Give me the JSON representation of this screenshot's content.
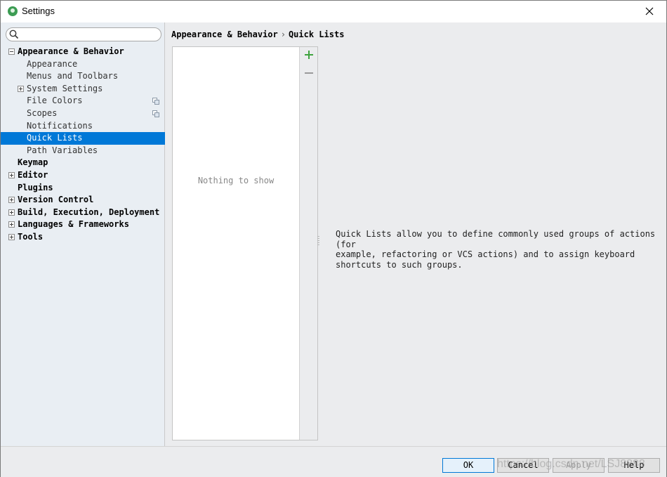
{
  "window": {
    "title": "Settings"
  },
  "search": {
    "placeholder": "",
    "value": ""
  },
  "tree": [
    {
      "label": "Appearance & Behavior",
      "level": 0,
      "expander": "minus",
      "selected": false,
      "icon": null
    },
    {
      "label": "Appearance",
      "level": 1,
      "expander": null,
      "selected": false,
      "icon": null
    },
    {
      "label": "Menus and Toolbars",
      "level": 1,
      "expander": null,
      "selected": false,
      "icon": null
    },
    {
      "label": "System Settings",
      "level": 1,
      "expander": "plus",
      "selected": false,
      "icon": null
    },
    {
      "label": "File Colors",
      "level": 1,
      "expander": null,
      "selected": false,
      "icon": "copy-icon"
    },
    {
      "label": "Scopes",
      "level": 1,
      "expander": null,
      "selected": false,
      "icon": "copy-icon"
    },
    {
      "label": "Notifications",
      "level": 1,
      "expander": null,
      "selected": false,
      "icon": null
    },
    {
      "label": "Quick Lists",
      "level": 1,
      "expander": null,
      "selected": true,
      "icon": null
    },
    {
      "label": "Path Variables",
      "level": 1,
      "expander": null,
      "selected": false,
      "icon": null
    },
    {
      "label": "Keymap",
      "level": 0,
      "expander": null,
      "selected": false,
      "icon": null
    },
    {
      "label": "Editor",
      "level": 0,
      "expander": "plus",
      "selected": false,
      "icon": null
    },
    {
      "label": "Plugins",
      "level": 0,
      "expander": null,
      "selected": false,
      "icon": null
    },
    {
      "label": "Version Control",
      "level": 0,
      "expander": "plus",
      "selected": false,
      "icon": null
    },
    {
      "label": "Build, Execution, Deployment",
      "level": 0,
      "expander": "plus",
      "selected": false,
      "icon": null
    },
    {
      "label": "Languages & Frameworks",
      "level": 0,
      "expander": "plus",
      "selected": false,
      "icon": null
    },
    {
      "label": "Tools",
      "level": 0,
      "expander": "plus",
      "selected": false,
      "icon": null
    }
  ],
  "breadcrumb": {
    "parent": "Appearance & Behavior",
    "separator": "›",
    "current": "Quick Lists"
  },
  "list": {
    "empty_text": "Nothing to show"
  },
  "toolbar": {
    "add_icon": "plus-icon",
    "remove_icon": "minus-icon",
    "add_color": "#3fa33f",
    "remove_color": "#9a9a9a"
  },
  "description": "Quick Lists allow you to define commonly used groups of actions (for\nexample, refactoring or VCS actions) and to assign keyboard\nshortcuts to such groups.",
  "buttons": {
    "ok": "OK",
    "cancel": "Cancel",
    "apply": "Apply",
    "help": "Help"
  },
  "watermark": "https://blog.csdn.net/LSJ8888",
  "colors": {
    "selection": "#0078d7",
    "sidebar_bg": "#e9eef3",
    "panel_bg": "#ebecee"
  }
}
